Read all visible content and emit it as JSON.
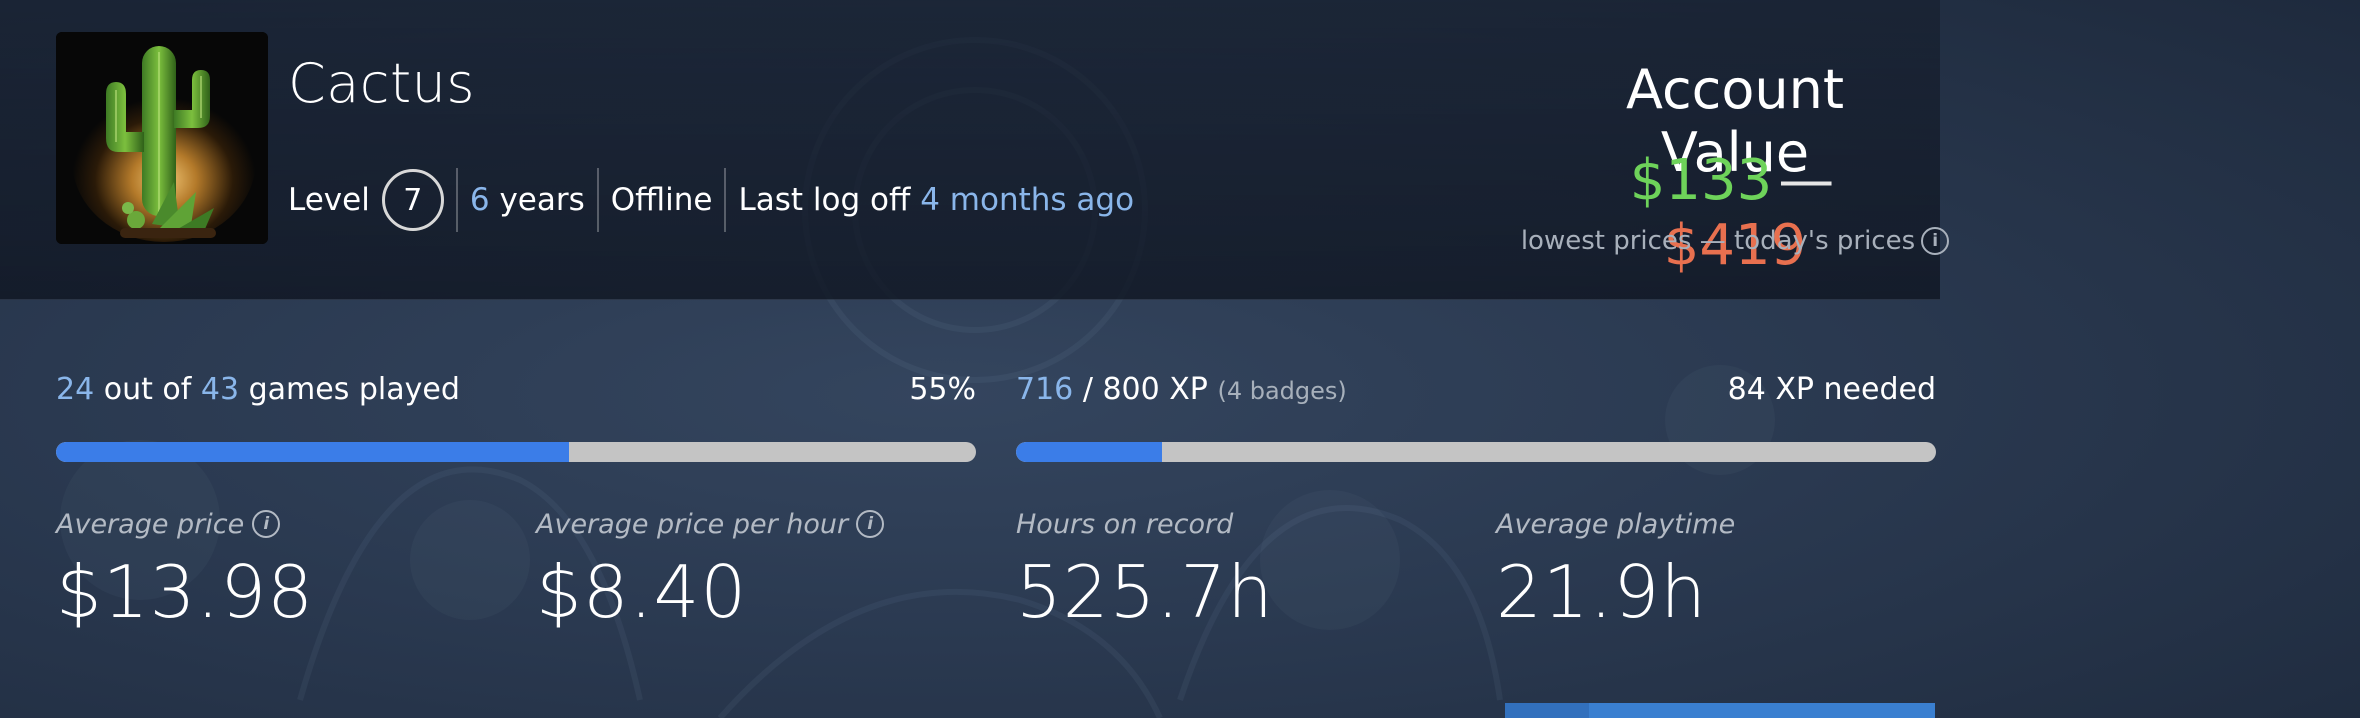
{
  "profile": {
    "username": "Cactus",
    "level_label": "Level",
    "level": "7",
    "years_number": "6",
    "years_label": "years",
    "status": "Offline",
    "last_logoff_label": "Last log off",
    "last_logoff_value": "4 months ago",
    "avatar_icon": "cactus-avatar"
  },
  "account_value": {
    "title": "Account Value",
    "low": "$133",
    "separator": "—",
    "high": "$419",
    "subtitle": "lowest prices — today's prices",
    "info_icon": "info-icon",
    "low_color": "#6ed35a",
    "high_color": "#e8704f"
  },
  "games_progress": {
    "played": "24",
    "out_of_label": "out of",
    "total": "43",
    "games_played_label": "games played",
    "percent_label": "55%",
    "fraction": 0.558
  },
  "xp_progress": {
    "current": "716",
    "slash_total": "/ 800 XP",
    "badges": "(4 badges)",
    "needed": "84 XP needed",
    "fraction": 0.1585
  },
  "stats": [
    {
      "label": "Average price",
      "value": "$13.98",
      "has_info": true
    },
    {
      "label": "Average price per hour",
      "value": "$8.40",
      "has_info": true
    },
    {
      "label": "Hours on record",
      "value": "525.7h",
      "has_info": false
    },
    {
      "label": "Average playtime",
      "value": "21.9h",
      "has_info": false
    }
  ],
  "colors": {
    "accent": "#8ab6ea",
    "progress_fill": "#3b7de8",
    "progress_track": "#c4c4c4"
  }
}
